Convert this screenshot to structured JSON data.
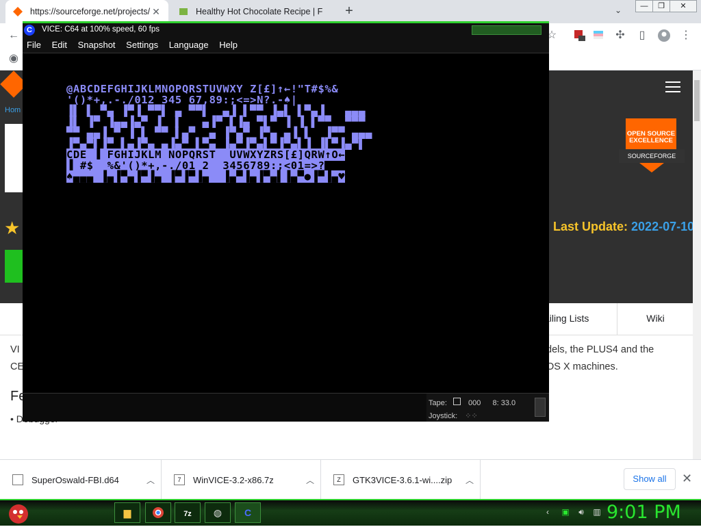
{
  "browser": {
    "tabs": [
      {
        "title": "https://sourceforge.net/projects/",
        "active": true
      },
      {
        "title": "Healthy Hot Chocolate Recipe | F",
        "active": false
      }
    ],
    "new_tab_label": "+",
    "close_glyph": "✕",
    "window_controls": [
      "—",
      "❐",
      "✕"
    ]
  },
  "page": {
    "breadcrumb": "Hom",
    "badge": {
      "line1": "OPEN SOURCE",
      "line2": "EXCELLENCE",
      "ribbon": "SOURCEFORGE"
    },
    "last_update_label": "Last Update:",
    "last_update_date": "2022-07-10",
    "tabs": {
      "mailing": "ailing Lists",
      "wiki": "Wiki"
    },
    "desc_left_1": "VI",
    "desc_left_2": "CE",
    "desc_right_1": "dels, the PLUS4 and the",
    "desc_right_2": "OS X machines.",
    "features_heading": "Fe",
    "feature_1": "• Debugger"
  },
  "downloads": {
    "items": [
      {
        "name": "SuperOswald-FBI.d64"
      },
      {
        "name": "WinVICE-3.2-x86.7z"
      },
      {
        "name": "GTK3VICE-3.6.1-wi....zip"
      }
    ],
    "show_all": "Show all"
  },
  "taskbar": {
    "clock": "9:01 PM"
  },
  "vice": {
    "title": "VICE: C64 at 100% speed, 60 fps",
    "menu": [
      "File",
      "Edit",
      "Snapshot",
      "Settings",
      "Language",
      "Help"
    ],
    "screen_line_1": "@ABCDEFGHIJKLMNOPQRSTUVWXY Z[£]↑←!\"T#$%&",
    "screen_line_2": "'()*+,.-./012 345 67,89:;<=>N?.-♠|",
    "status": {
      "tape_label": "Tape:",
      "tape_counter": "000",
      "drive": "8: 33.0",
      "joystick_label": "Joystick:"
    }
  }
}
